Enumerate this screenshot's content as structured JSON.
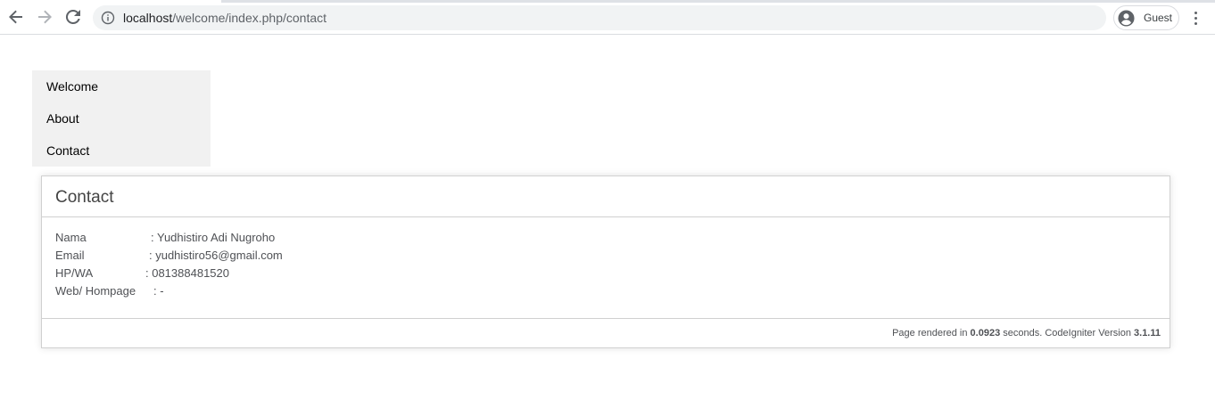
{
  "browser": {
    "url_host": "localhost",
    "url_path": "/welcome/index.php/contact",
    "profile_label": "Guest"
  },
  "nav": {
    "items": [
      {
        "label": "Welcome"
      },
      {
        "label": "About"
      },
      {
        "label": "Contact"
      }
    ]
  },
  "main": {
    "title": "Contact",
    "rows": [
      {
        "label": "Nama",
        "value": ": Yudhistiro Adi Nugroho"
      },
      {
        "label": "Email",
        "value": ": yudhistiro56@gmail.com"
      },
      {
        "label": "HP/WA",
        "value": ": 081388481520"
      },
      {
        "label": "Web/ Hompage",
        "value": ": -"
      }
    ],
    "footer": {
      "prefix": "Page rendered in ",
      "time": "0.0923",
      "middle": " seconds. CodeIgniter Version ",
      "version": "3.1.11"
    }
  },
  "colors": {
    "nav_bg": "#f1f1f1",
    "omnibox_bg": "#f1f3f4"
  }
}
